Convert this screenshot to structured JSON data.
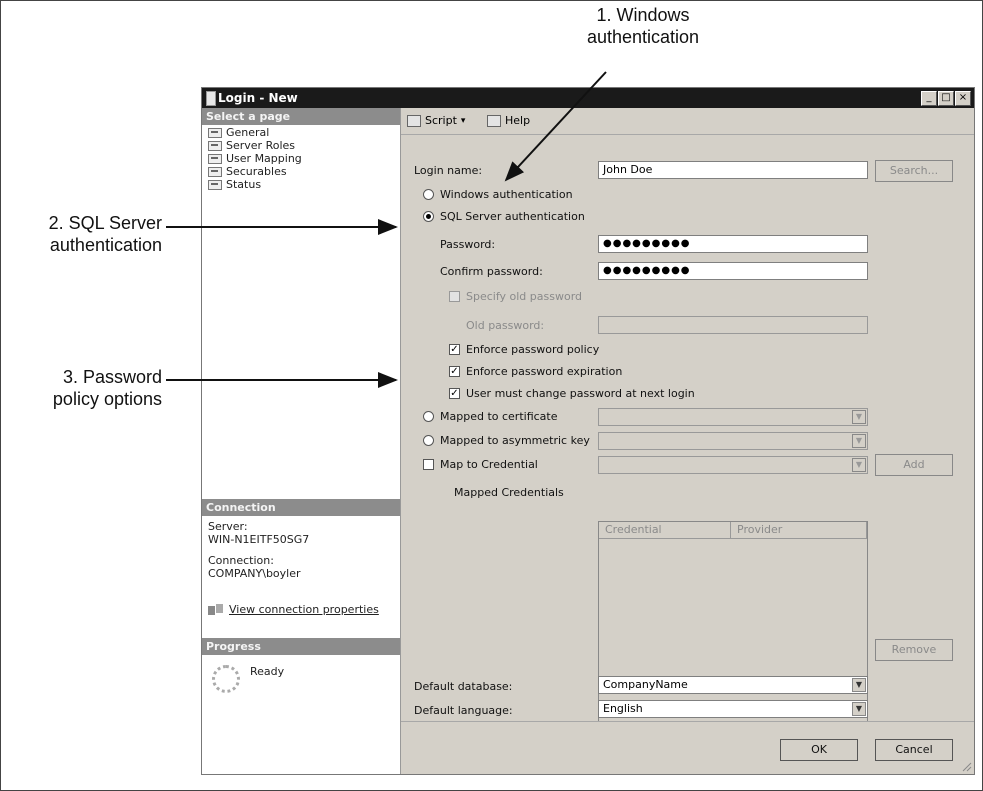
{
  "callouts": {
    "windows_auth": [
      "1. Windows",
      "authentication"
    ],
    "sql_auth": [
      "2. SQL Server",
      "authentication"
    ],
    "password_policy": [
      "3. Password",
      "policy options"
    ]
  },
  "dialog": {
    "title": "Login - New",
    "title_buttons": [
      "_",
      "□",
      "×"
    ]
  },
  "left_pane": {
    "select_page_header": "Select a page",
    "pages": [
      "General",
      "Server Roles",
      "User Mapping",
      "Securables",
      "Status"
    ],
    "connection_header": "Connection",
    "server_label": "Server:",
    "server_value": "WIN-N1EITF50SG7",
    "connection_label": "Connection:",
    "connection_value": "COMPANY\\boyler",
    "view_connection_properties": "View connection properties",
    "progress_header": "Progress",
    "progress_status": "Ready"
  },
  "toolbar": {
    "script_label": "Script",
    "script_dropdown": "▾",
    "help_label": "Help"
  },
  "form": {
    "login_name_label": "Login name:",
    "login_name_value": "John Doe",
    "search_button": "Search...",
    "windows_auth_label": "Windows authentication",
    "sql_auth_label": "SQL Server authentication",
    "password_label": "Password:",
    "password_value": "●●●●●●●●●",
    "confirm_password_label": "Confirm password:",
    "confirm_password_value": "●●●●●●●●●",
    "specify_old_password_label": "Specify old password",
    "old_password_label": "Old password:",
    "enforce_policy_label": "Enforce password policy",
    "enforce_expiration_label": "Enforce password expiration",
    "must_change_label": "User must change password at next login",
    "mapped_certificate_label": "Mapped to certificate",
    "mapped_asym_key_label": "Mapped to asymmetric key",
    "map_credential_label": "Map to Credential",
    "add_button": "Add",
    "mapped_credentials_label": "Mapped Credentials",
    "credential_col": "Credential",
    "provider_col": "Provider",
    "remove_button": "Remove",
    "default_database_label": "Default database:",
    "default_database_value": "CompanyName",
    "default_language_label": "Default language:",
    "default_language_value": "English",
    "combo_arrow": "▼",
    "check_mark": "✓"
  },
  "footer": {
    "ok_button": "OK",
    "cancel_button": "Cancel"
  }
}
